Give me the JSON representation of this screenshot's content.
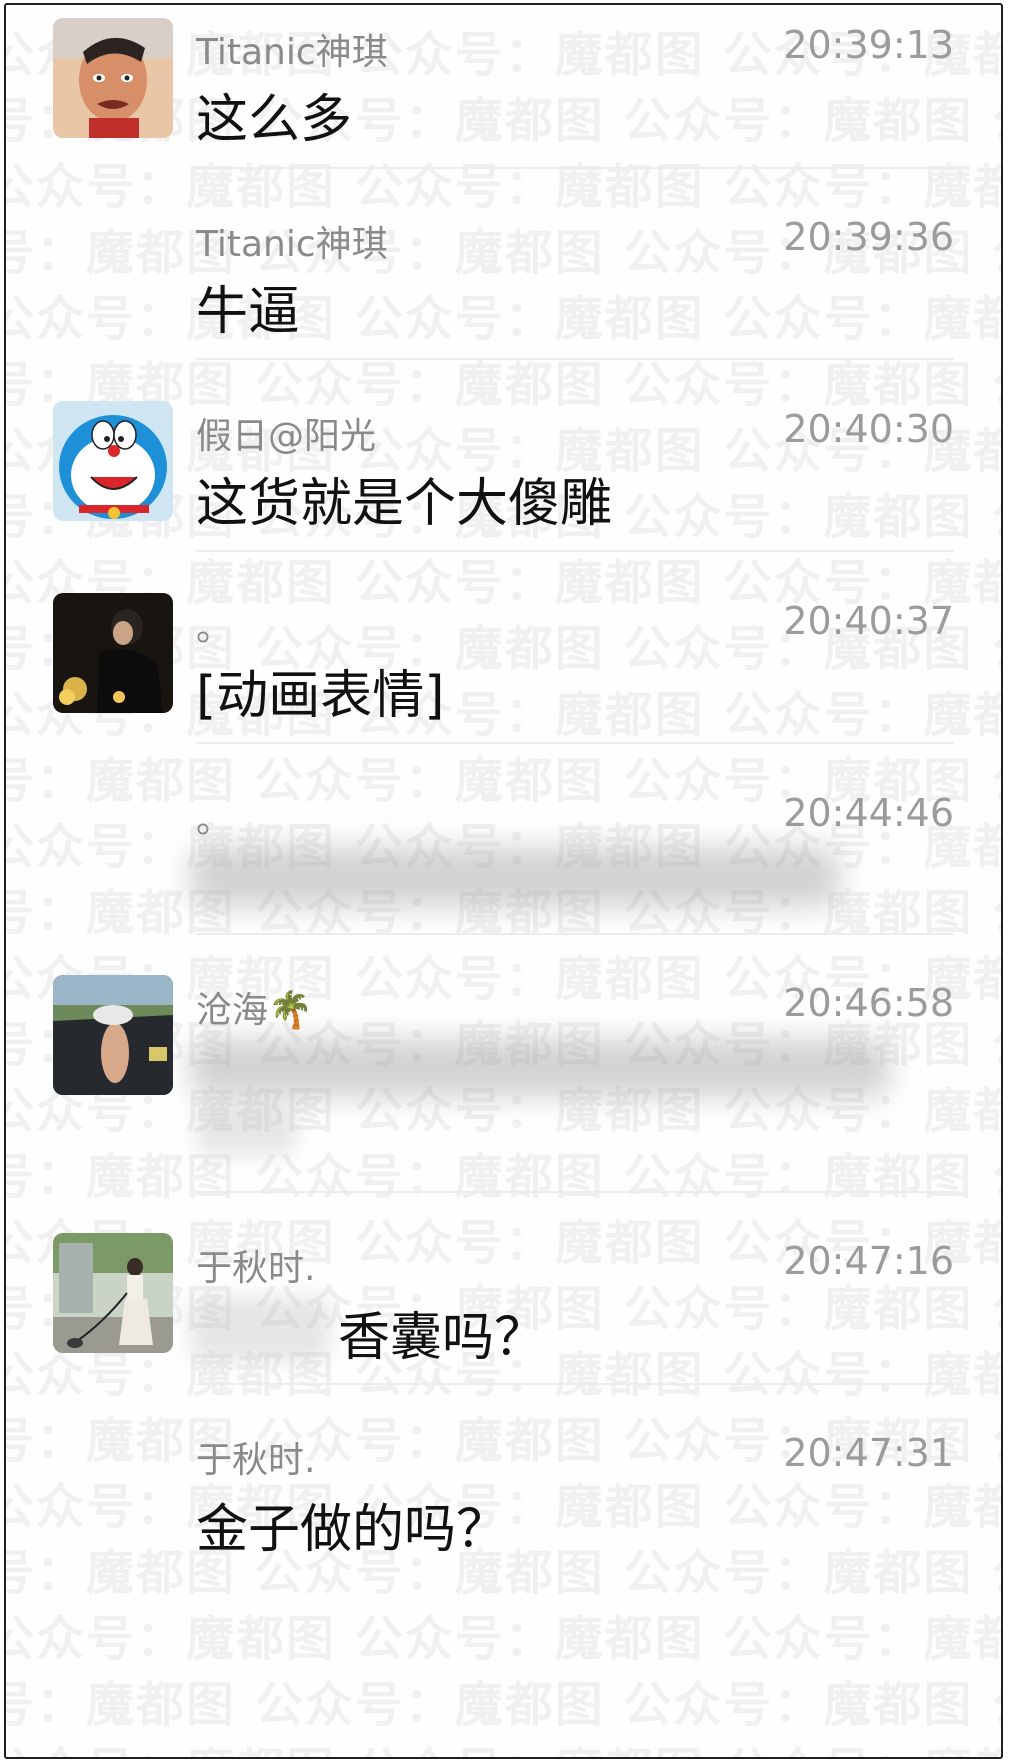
{
  "watermark": {
    "text": "公众号：魔都图"
  },
  "messages": [
    {
      "sender": "Titanic神琪",
      "time": "20:39:13",
      "text": "这么多",
      "avatar_icon": "angry-man-avatar-icon"
    },
    {
      "sender": "Titanic神琪",
      "time": "20:39:36",
      "text": "牛逼"
    },
    {
      "sender": "假日@阳光",
      "time": "20:40:30",
      "text": "这货就是个大傻雕",
      "avatar_icon": "doraemon-avatar-icon"
    },
    {
      "sender": "。",
      "time": "20:40:37",
      "text": "[动画表情]",
      "avatar_icon": "dark-photo-avatar-icon"
    },
    {
      "sender": "。",
      "time": "20:44:46",
      "text": ""
    },
    {
      "sender": "沧海🌴",
      "time": "20:46:58",
      "text": "",
      "avatar_icon": "car-window-avatar-icon"
    },
    {
      "sender": "于秋时.",
      "time": "20:47:16",
      "text": "香囊吗？",
      "avatar_icon": "street-girl-avatar-icon"
    },
    {
      "sender": "于秋时.",
      "time": "20:47:31",
      "text": "金子做的吗？"
    }
  ]
}
